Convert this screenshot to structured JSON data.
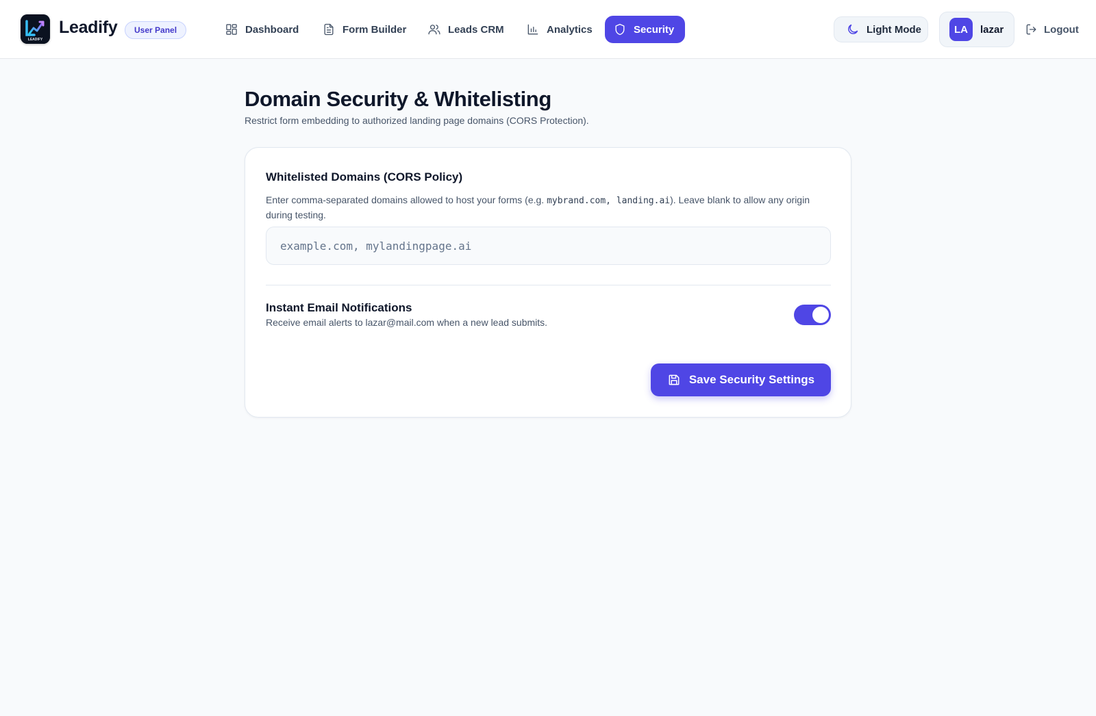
{
  "brand": {
    "name": "Leadify",
    "badge": "User Panel",
    "logo_icon": "leadify-logo-icon",
    "logo_text": "LEADIFY"
  },
  "nav": {
    "items": [
      {
        "label": "Dashboard",
        "icon": "grid-icon"
      },
      {
        "label": "Form Builder",
        "icon": "document-icon"
      },
      {
        "label": "Leads CRM",
        "icon": "users-icon"
      },
      {
        "label": "Analytics",
        "icon": "bar-chart-icon"
      },
      {
        "label": "Security",
        "icon": "shield-icon",
        "active": true
      }
    ]
  },
  "header_right": {
    "theme_label": "Light Mode",
    "avatar_initials": "LA",
    "username": "lazar",
    "logout_label": "Logout"
  },
  "page": {
    "title": "Domain Security & Whitelisting",
    "subtitle": "Restrict form embedding to authorized landing page domains (CORS Protection)."
  },
  "whitelist": {
    "title": "Whitelisted Domains (CORS Policy)",
    "desc_before": "Enter comma-separated domains allowed to host your forms (e.g. ",
    "example_code": "mybrand.com, landing.ai",
    "desc_after": "). Leave blank to allow any origin during testing.",
    "input_value": "",
    "input_placeholder": "example.com, mylandingpage.ai"
  },
  "notifications": {
    "title": "Instant Email Notifications",
    "desc": "Receive email alerts to lazar@mail.com when a new lead submits.",
    "enabled": true
  },
  "actions": {
    "save_label": "Save Security Settings"
  },
  "colors": {
    "accent": "#4f46e5",
    "background": "#f8fafc",
    "card": "#ffffff",
    "text": "#0f172a",
    "muted": "#475569"
  }
}
